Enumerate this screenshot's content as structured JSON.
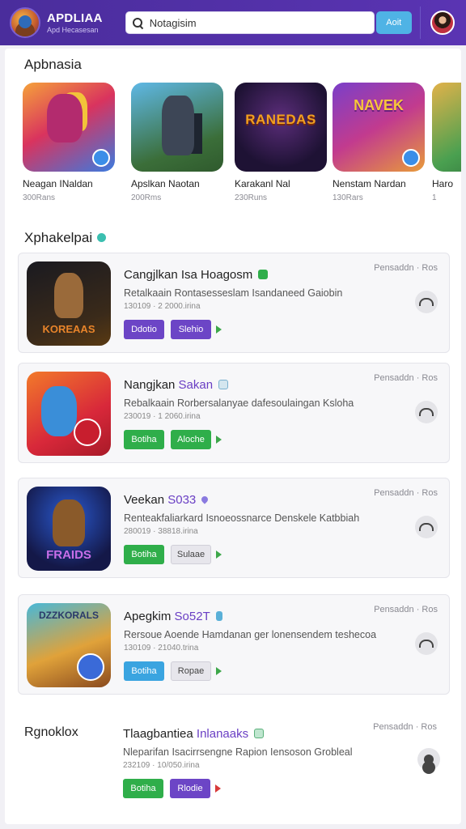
{
  "header": {
    "brand_title": "APDLIAA",
    "brand_subtitle": "Apd Hecasesan",
    "search_value": "Notagisim",
    "search_button": "Aoit"
  },
  "carousel": {
    "title": "Apbnasia",
    "items": [
      {
        "name": "Neagan INaldan",
        "sub": "300Rans"
      },
      {
        "name": "Apslkan Naotan",
        "sub": "200Rms"
      },
      {
        "name": "Karakanl Nal",
        "sub": "230Runs"
      },
      {
        "name": "Nenstam Nardan",
        "sub": "130Rars"
      },
      {
        "name": "Haro",
        "sub": "1"
      }
    ]
  },
  "list_section": {
    "title": "Xphakelpai",
    "rows": [
      {
        "title": "Cangjlkan Isa Hoagosm",
        "title_accent": "",
        "desc": "Retalkaain Rontasesseslam Isandaneed Gaiobin",
        "meta": "130109  ·  2 2000.irina",
        "publisher": "Pensaddn · Ros",
        "btn1": "Ddotio",
        "btn2": "Slehio"
      },
      {
        "title": "Nangjkan ",
        "title_accent": "Sakan",
        "desc": "Rebalkaain Rorbersalanyae dafesoulaingan Ksloha",
        "meta": "230019  ·  1 2060.irina",
        "publisher": "Pensaddn · Ros",
        "btn1": "Botiha",
        "btn2": "Aloche"
      },
      {
        "title": "Veekan ",
        "title_accent": "S033",
        "desc": "Renteakfaliarkard Isnoeossnarce Denskele Katbbiah",
        "meta": "280019  ·  38818.irina",
        "publisher": "Pensaddn · Ros",
        "btn1": "Botiha",
        "btn2": "Sulaae"
      },
      {
        "title": "Apegkim ",
        "title_accent": "So52T",
        "desc": "Rersoue Aoende Hamdanan ger lonensendem teshecoa",
        "meta": "130109  ·  21040.trina",
        "publisher": "Pensaddn · Ros",
        "btn1": "Botiha",
        "btn2": "Ropae"
      }
    ]
  },
  "bottom_section": {
    "title": "Rgnoklox",
    "row": {
      "title": "Tlaagbantiea ",
      "title_accent": "Inlanaaks",
      "desc": "Nleparifan Isacirrsengne Rapion Iensoson Grobleal",
      "meta": "232109  ·  10/050.irina",
      "publisher": "Pensaddn · Ros",
      "btn1": "Botiha",
      "btn2": "Rlodie"
    }
  },
  "colors": {
    "header_bg": "#4a2d9c",
    "purple_btn": "#6c45c6",
    "green_btn": "#2fae4a",
    "blue_btn": "#3aa4e0",
    "accent_text": "#6a3fc4"
  }
}
